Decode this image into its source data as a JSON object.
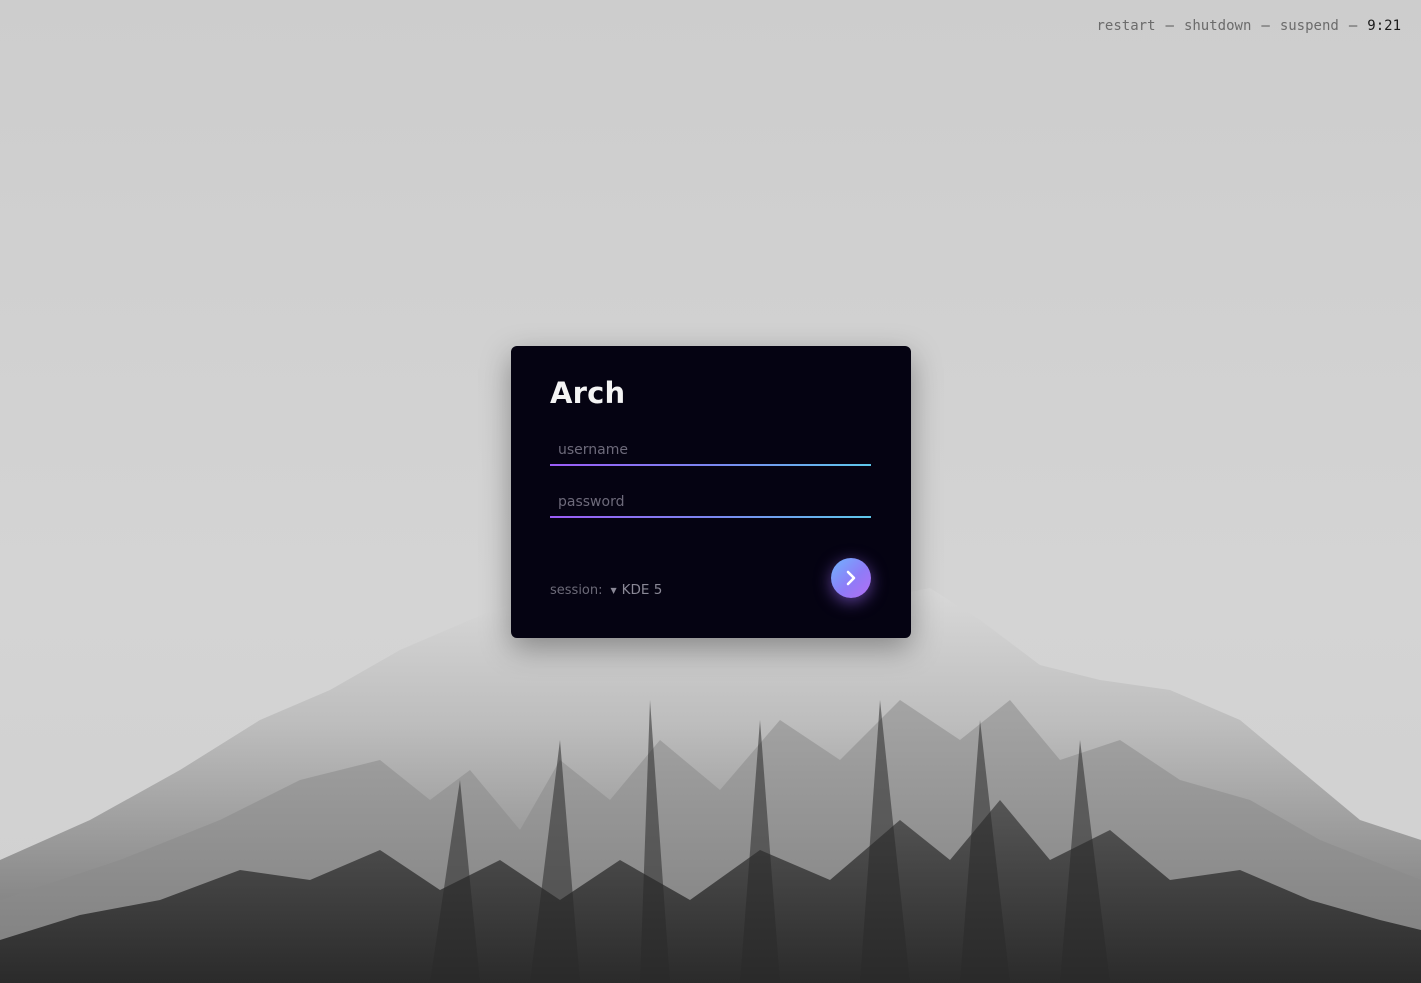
{
  "topbar": {
    "restart_label": "restart",
    "shutdown_label": "shutdown",
    "suspend_label": "suspend",
    "separator": "—",
    "clock": "9:21"
  },
  "login": {
    "hostname": "Arch",
    "username_placeholder": "username",
    "password_placeholder": "password",
    "session_label": "session:",
    "session_value": "KDE 5",
    "submit_icon": "chevron-right-icon"
  },
  "colors": {
    "card_background": "#050312",
    "underline_start": "#9b5cf6",
    "underline_end": "#5ec8ec",
    "button_start": "#6fb4ff",
    "button_end": "#b46ef5"
  },
  "wallpaper": {
    "subject": "snow-mountain"
  }
}
